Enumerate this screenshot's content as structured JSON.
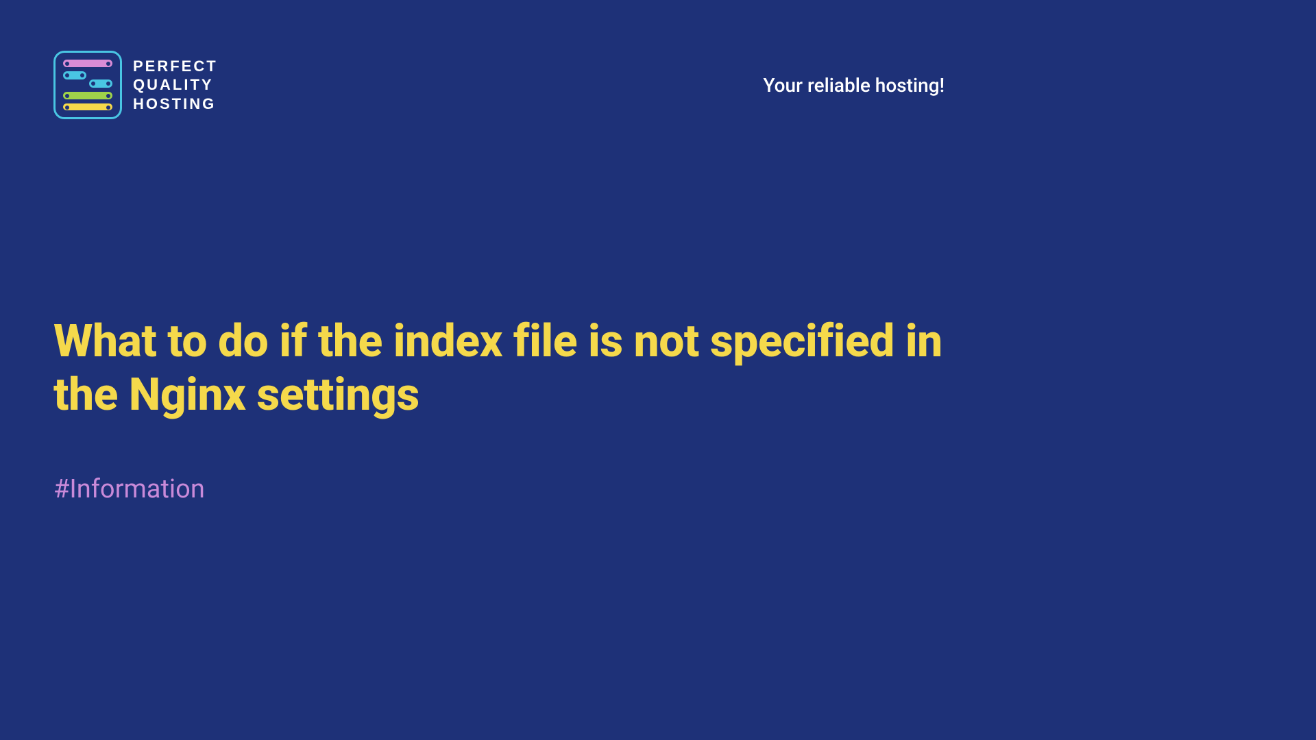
{
  "brand": {
    "line1": "PERFECT",
    "line2": "QUALITY",
    "line3": "HOSTING"
  },
  "tagline": "Your reliable hosting!",
  "title": "What to do if the index file is not specified in the Nginx settings",
  "hashtag": "#Information",
  "colors": {
    "background": "#1e3178",
    "accent_yellow": "#f5d94b",
    "accent_purple": "#c98ad9",
    "accent_cyan": "#49c5e3"
  }
}
